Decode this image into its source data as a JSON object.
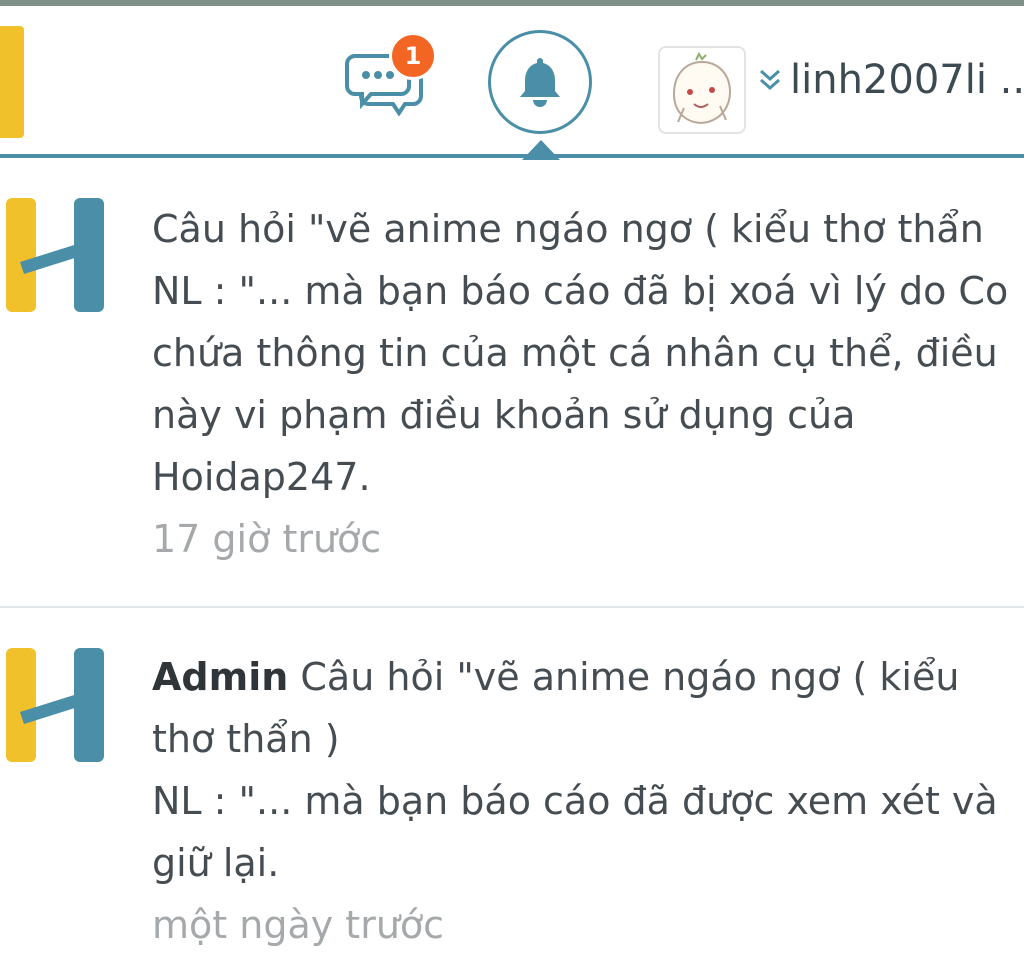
{
  "header": {
    "messages": {
      "icon": "chat-bubbles-icon",
      "badge_count": "1",
      "badge_color": "#f26522"
    },
    "notifications": {
      "icon": "bell-icon",
      "accent_color": "#4a8fa7"
    },
    "user": {
      "avatar_icon": "avatar-icon",
      "dropdown_icon": "double-chevron-down-icon",
      "name": "linh2007li .."
    }
  },
  "notifications": [
    {
      "logo_icon": "hoidap-h-logo-icon",
      "lines": [
        "Câu hỏi \"vẽ anime ngáo ngơ ( kiểu thơ thẩn",
        "NL : \"... mà bạn báo cáo đã bị xoá vì lý do Co",
        "chứa thông tin của một cá nhân cụ thể, điều",
        "này vi phạm điều khoản sử dụng của",
        "Hoidap247."
      ],
      "time": "17 giờ trước"
    },
    {
      "logo_icon": "hoidap-h-logo-icon",
      "author": "Admin",
      "first_line": " Câu hỏi \"vẽ anime ngáo ngơ ( kiểu",
      "lines": [
        "thơ thẩn )",
        "NL : \"... mà bạn báo cáo đã được xem xét và",
        "giữ lại."
      ],
      "time": "một ngày trước"
    }
  ],
  "colors": {
    "brand_yellow": "#f0c12a",
    "brand_teal": "#4a8fa7",
    "text": "#454d52",
    "muted": "#a5a9ab"
  }
}
